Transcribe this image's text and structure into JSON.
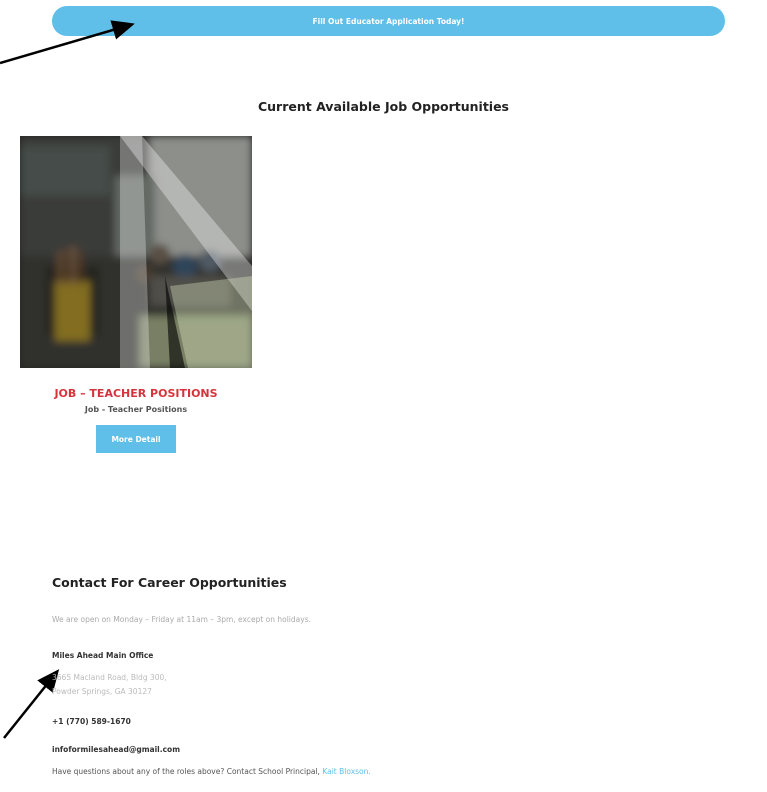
{
  "cta": {
    "label": "Fill Out Educator Application Today!"
  },
  "jobs_section": {
    "title": "Current Available Job Opportunities",
    "jobs": [
      {
        "title": "JOB – TEACHER POSITIONS",
        "subtitle": "Job - Teacher Positions",
        "button_label": "More Detail"
      }
    ]
  },
  "contact": {
    "title": "Contact For Career Opportunities",
    "hours": "We are open on Monday – Friday at 11am – 3pm, except on holidays.",
    "office_name": "Miles Ahead Main Office",
    "address_line1": "3665 Macland Road, Bldg 300,",
    "address_line2": "Powder Springs, GA 30127",
    "phone": "+1 (770) 589-1670",
    "email": "infoformilesahead@gmail.com",
    "questions_text": "Have questions about any of the roles above? Contact School Principal,",
    "principal_link": "Kait Bloxson."
  },
  "colors": {
    "accent_blue": "#5fbfe8",
    "job_title_red": "#d6343c",
    "annotation_arrow": "#000000"
  }
}
